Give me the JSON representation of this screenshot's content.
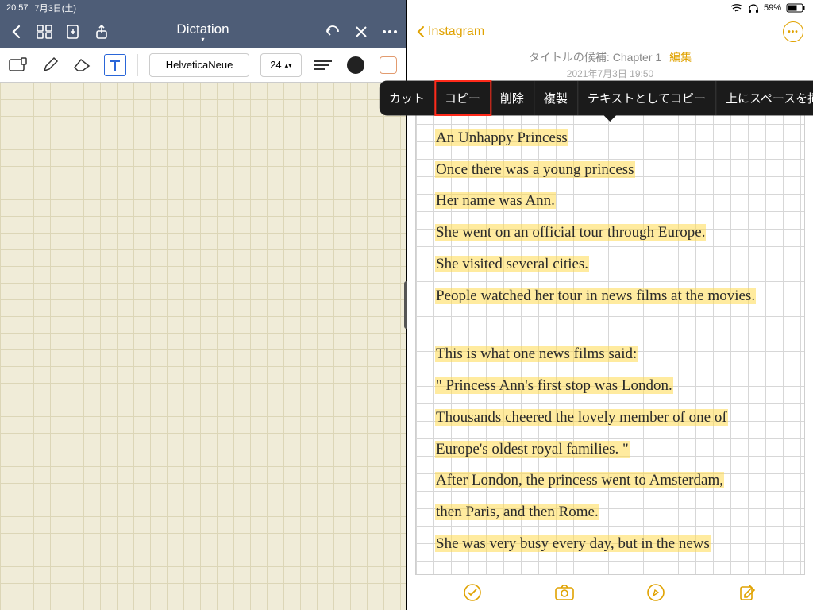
{
  "status": {
    "time": "20:57",
    "date": "7月3日(土)",
    "battery": "59%"
  },
  "left": {
    "title": "Dictation",
    "toolbar": {
      "font": "HelveticaNeue",
      "size": "24"
    }
  },
  "right": {
    "back_label": "Instagram",
    "title_prefix": "タイトルの候補: ",
    "title_value": "Chapter 1",
    "edit_label": "編集",
    "date": "2021年7月3日 19:50",
    "context_menu": [
      "カット",
      "コピー",
      "削除",
      "複製",
      "テキストとしてコピー",
      "上にスペースを挿入"
    ],
    "context_highlight_index": 1,
    "handwriting": [
      "Chapter 1",
      "An Unhappy Princess",
      "Once there was a young princess",
      "Her name was Ann.",
      "She went on an official tour through Europe.",
      "She visited several cities.",
      "People watched her tour in news films at the movies.",
      "",
      "This is what one news films said:",
      "\" Princess Ann's first stop was London.",
      "Thousands cheered the lovely member of one of",
      "Europe's oldest royal families. \"",
      "After London, the princess went to Amsterdam,",
      "then Paris, and then Rome.",
      "She was very busy every day, but in the news"
    ]
  }
}
